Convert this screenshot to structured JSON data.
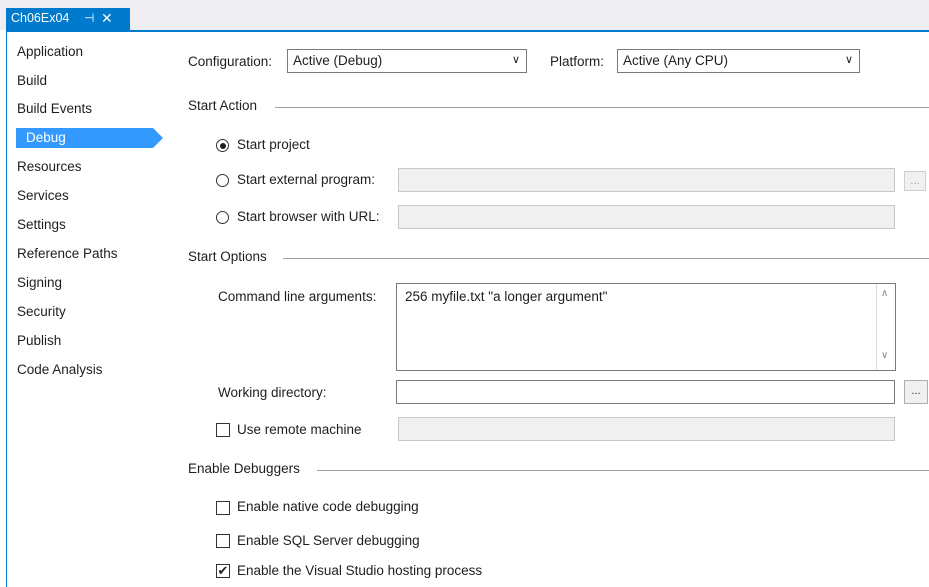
{
  "tab": {
    "title": "Ch06Ex04",
    "pin": "⊣",
    "close": "✕"
  },
  "sidebar": {
    "items": [
      {
        "label": "Application"
      },
      {
        "label": "Build"
      },
      {
        "label": "Build Events"
      },
      {
        "label": "Debug"
      },
      {
        "label": "Resources"
      },
      {
        "label": "Services"
      },
      {
        "label": "Settings"
      },
      {
        "label": "Reference Paths"
      },
      {
        "label": "Signing"
      },
      {
        "label": "Security"
      },
      {
        "label": "Publish"
      },
      {
        "label": "Code Analysis"
      }
    ],
    "selected": "Debug"
  },
  "config": {
    "configuration_label": "Configuration:",
    "configuration_value": "Active (Debug)",
    "platform_label": "Platform:",
    "platform_value": "Active (Any CPU)"
  },
  "start_action": {
    "heading": "Start Action",
    "start_project": "Start project",
    "start_external": "Start external program:",
    "start_browser": "Start browser with URL:",
    "browse_label": "..."
  },
  "start_options": {
    "heading": "Start Options",
    "cmd_label": "Command line arguments:",
    "cmd_value": "256 myfile.txt \"a longer argument\"",
    "workdir_label": "Working directory:",
    "workdir_browse": "...",
    "remote_label": "Use remote machine"
  },
  "debuggers": {
    "heading": "Enable Debuggers",
    "native": "Enable native code debugging",
    "sql": "Enable SQL Server debugging",
    "hosting": "Enable the Visual Studio hosting process"
  },
  "colors": {
    "accent": "#007acc",
    "selection": "#3399ff"
  }
}
